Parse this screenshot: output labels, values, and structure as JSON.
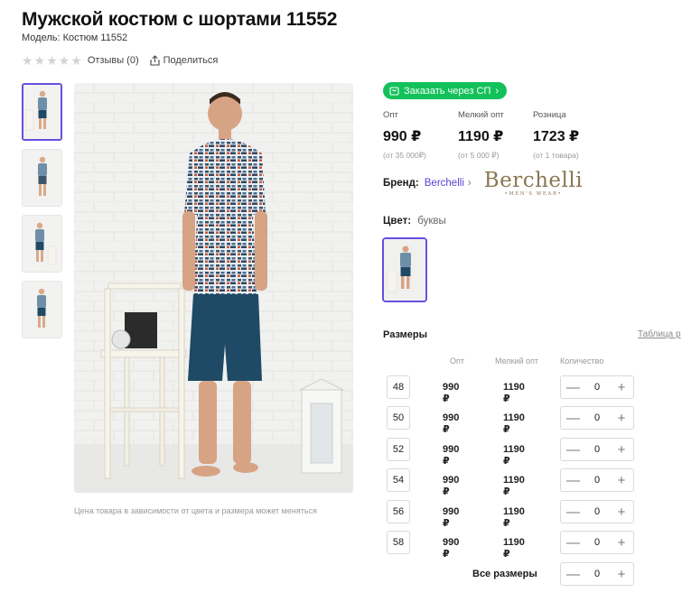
{
  "product": {
    "title": "Мужской костюм с шортами 11552",
    "model": "Модель: Костюм 11552",
    "reviews": "Отзывы (0)",
    "share": "Поделиться",
    "price_note": "Цена товара в зависимости от цвета и размера может меняться"
  },
  "order_button": "Заказать через СП",
  "prices": [
    {
      "label": "Опт",
      "value": "990 ₽",
      "sub": "(от 35 000₽)"
    },
    {
      "label": "Мелкий опт",
      "value": "1190 ₽",
      "sub": "(от 5 000 ₽)"
    },
    {
      "label": "Розница",
      "value": "1723 ₽",
      "sub": "(от 1 товара)"
    }
  ],
  "brand": {
    "label": "Бренд:",
    "name": "Berchelli",
    "logo_name": "Berchelli",
    "logo_tag": "•MEN'S WEAR•"
  },
  "color": {
    "label": "Цвет:",
    "value": "буквы"
  },
  "sizes": {
    "title": "Размеры",
    "table_link": "Таблица р",
    "headers": {
      "opt": "Опт",
      "melkiy": "Мелкий опт",
      "qty": "Количество"
    },
    "rows": [
      {
        "size": "48",
        "opt": "990 ₽",
        "melkiy": "1190 ₽",
        "qty": "0"
      },
      {
        "size": "50",
        "opt": "990 ₽",
        "melkiy": "1190 ₽",
        "qty": "0"
      },
      {
        "size": "52",
        "opt": "990 ₽",
        "melkiy": "1190 ₽",
        "qty": "0"
      },
      {
        "size": "54",
        "opt": "990 ₽",
        "melkiy": "1190 ₽",
        "qty": "0"
      },
      {
        "size": "56",
        "opt": "990 ₽",
        "melkiy": "1190 ₽",
        "qty": "0"
      },
      {
        "size": "58",
        "opt": "990 ₽",
        "melkiy": "1190 ₽",
        "qty": "0"
      }
    ],
    "all_label": "Все размеры",
    "all_qty": "0",
    "minus_glyph": "—",
    "plus_glyph": "+"
  },
  "colors": {
    "accent": "#6a4ee0",
    "order_green": "#13c15a",
    "shirt": "#6f8fa8",
    "shorts": "#1f4a66"
  },
  "icons": [
    "star-icon",
    "share-icon",
    "cart-icon",
    "chevron-right-icon",
    "minus-icon",
    "plus-icon"
  ]
}
